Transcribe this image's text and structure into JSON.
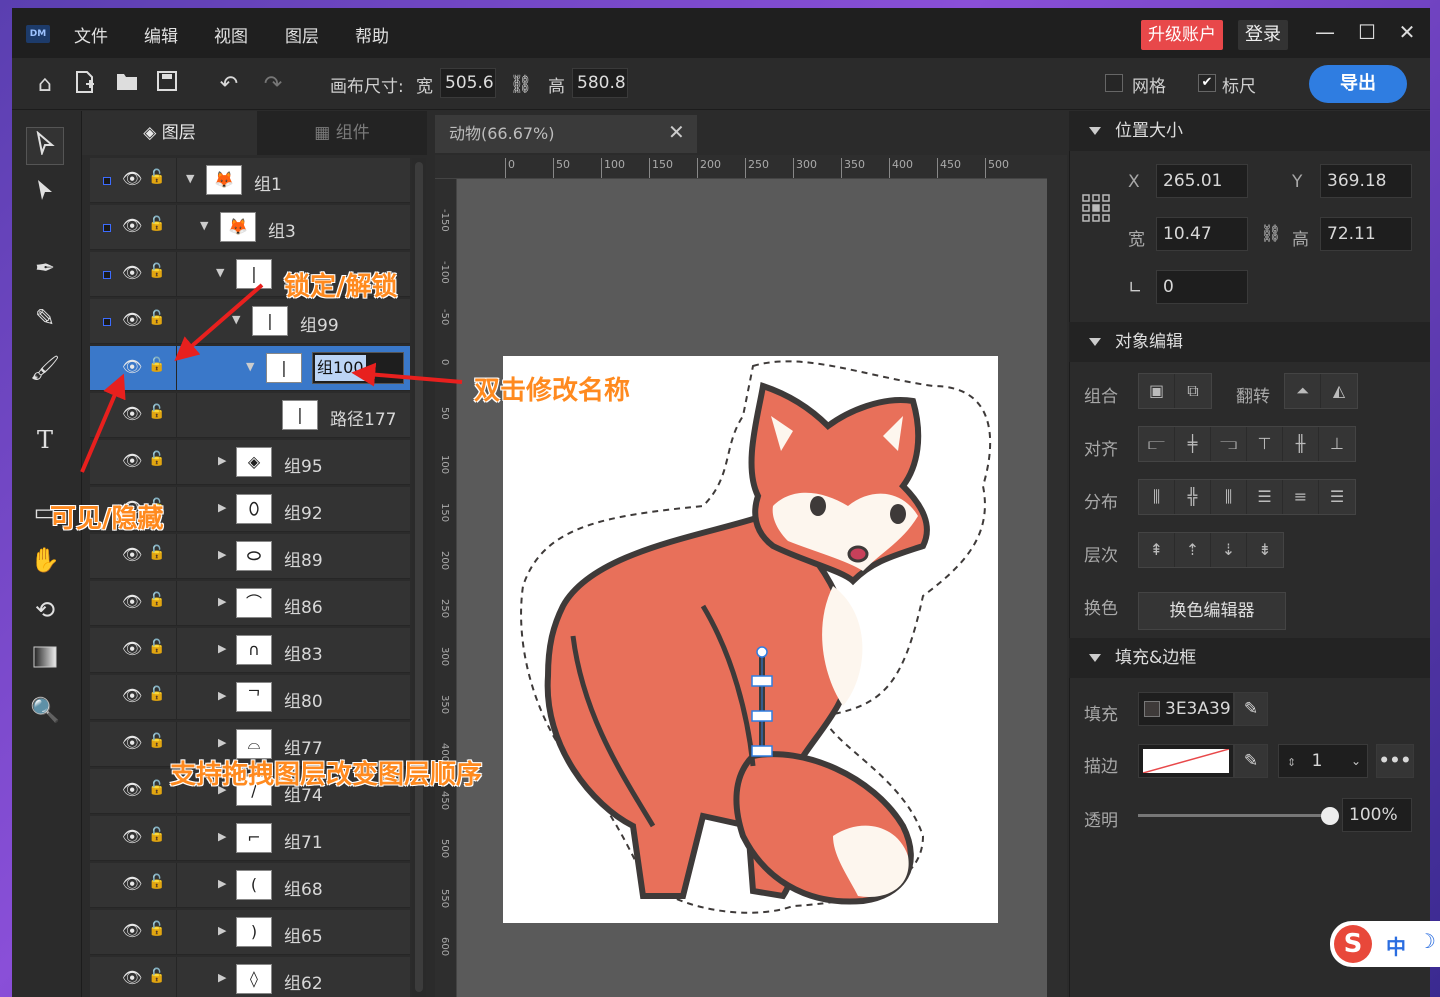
{
  "app": {
    "logo": "DM"
  },
  "menu": [
    "文件",
    "编辑",
    "视图",
    "图层",
    "帮助"
  ],
  "title_buttons": {
    "upgrade": "升级账户",
    "login": "登录"
  },
  "toolbar": {
    "canvas_size_label": "画布尺寸:",
    "width_label": "宽",
    "width_value": "505.6",
    "height_label": "高",
    "height_value": "580.8",
    "grid_label": "网格",
    "grid_checked": false,
    "ruler_label": "标尺",
    "ruler_checked": true,
    "export_label": "导出"
  },
  "panel_tabs": {
    "layers": "图层",
    "components": "组件"
  },
  "layers": [
    {
      "name": "组1",
      "indent": 0,
      "expanded": true,
      "dot": true,
      "thumb": "fox"
    },
    {
      "name": "组3",
      "indent": 1,
      "expanded": true,
      "dot": true,
      "thumb": "fox"
    },
    {
      "name": "",
      "indent": 2,
      "expanded": true,
      "dot": true,
      "thumb": "stroke"
    },
    {
      "name": "组99",
      "indent": 3,
      "expanded": true,
      "dot": true,
      "thumb": "stroke"
    },
    {
      "name": "组100",
      "indent": 4,
      "expanded": true,
      "dot": false,
      "thumb": "stroke",
      "selected": true,
      "editing": true
    },
    {
      "name": "路径177",
      "indent": 5,
      "expanded": null,
      "dot": false,
      "thumb": "stroke"
    },
    {
      "name": "组95",
      "indent": 2,
      "expanded": false,
      "dot": false,
      "thumb": "leaf"
    },
    {
      "name": "组92",
      "indent": 2,
      "expanded": false,
      "dot": false,
      "thumb": "oval"
    },
    {
      "name": "组89",
      "indent": 2,
      "expanded": false,
      "dot": false,
      "thumb": "oval"
    },
    {
      "name": "组86",
      "indent": 2,
      "expanded": false,
      "dot": false,
      "thumb": "line"
    },
    {
      "name": "组83",
      "indent": 2,
      "expanded": false,
      "dot": false,
      "thumb": "curve"
    },
    {
      "name": "组80",
      "indent": 2,
      "expanded": false,
      "dot": false,
      "thumb": "curve"
    },
    {
      "name": "组77",
      "indent": 2,
      "expanded": false,
      "dot": false,
      "thumb": "line"
    },
    {
      "name": "组74",
      "indent": 2,
      "expanded": false,
      "dot": false,
      "thumb": "line"
    },
    {
      "name": "组71",
      "indent": 2,
      "expanded": false,
      "dot": false,
      "thumb": "line"
    },
    {
      "name": "组68",
      "indent": 2,
      "expanded": false,
      "dot": false,
      "thumb": "curve"
    },
    {
      "name": "组65",
      "indent": 2,
      "expanded": false,
      "dot": false,
      "thumb": "curve"
    },
    {
      "name": "组62",
      "indent": 2,
      "expanded": false,
      "dot": false,
      "thumb": "leaf"
    }
  ],
  "document_tab": {
    "title": "动物(66.67%)"
  },
  "ruler_h_ticks": [
    "0",
    "50",
    "100",
    "150",
    "200",
    "250",
    "300",
    "350",
    "400",
    "450",
    "500"
  ],
  "ruler_v_ticks": [
    "-150",
    "-100",
    "-50",
    "0",
    "50",
    "100",
    "150",
    "200",
    "250",
    "300",
    "350",
    "400",
    "450",
    "500",
    "550",
    "600"
  ],
  "position_size": {
    "title": "位置大小",
    "x_label": "X",
    "x_value": "265.01",
    "y_label": "Y",
    "y_value": "369.18",
    "w_label": "宽",
    "w_value": "10.47",
    "h_label": "高",
    "h_value": "72.11",
    "angle_value": "0"
  },
  "object_edit": {
    "title": "对象编辑",
    "group_label": "组合",
    "flip_label": "翻转",
    "align_label": "对齐",
    "distribute_label": "分布",
    "order_label": "层次",
    "recolor_label": "换色",
    "recolor_button": "换色编辑器"
  },
  "fill_stroke": {
    "title": "填充&边框",
    "fill_label": "填充",
    "fill_value": "3E3A39",
    "fill_color": "#3E3A39",
    "stroke_label": "描边",
    "stroke_width": "1",
    "opacity_label": "透明",
    "opacity_value": "100%",
    "opacity": 1.0
  },
  "annotations": {
    "lock": "锁定/解锁",
    "rename": "双击修改名称",
    "visible": "可见/隐藏",
    "drag": "支持拖拽图层改变图层顺序"
  },
  "ime": {
    "logo": "S",
    "mode": "中",
    "moon": "☽"
  },
  "colors": {
    "accent": "#2f7de1",
    "upgrade": "#e8484a",
    "annotation": "#ff8a1f",
    "fox_orange": "#e8705a",
    "outline": "#3e3a39"
  }
}
